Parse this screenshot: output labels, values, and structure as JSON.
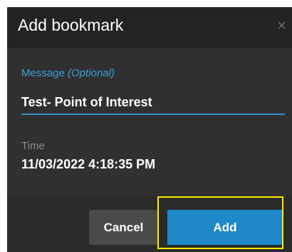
{
  "dialog": {
    "title": "Add bookmark",
    "close_glyph": "×"
  },
  "form": {
    "message_label": "Message ",
    "message_optional": "(Optional)",
    "message_value": "Test- Point of Interest",
    "time_label": "Time",
    "time_value": "11/03/2022 4:18:35 PM"
  },
  "footer": {
    "cancel_label": "Cancel",
    "add_label": "Add"
  },
  "colors": {
    "accent": "#1e88c8",
    "label_blue": "#3a9fd8",
    "highlight": "#ffea00"
  },
  "icons": {
    "close": "close-icon"
  }
}
